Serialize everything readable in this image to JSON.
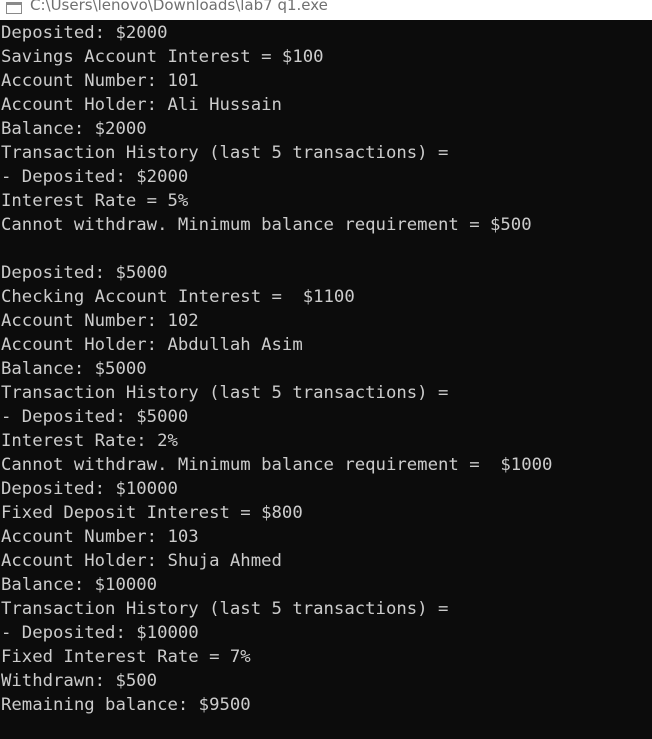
{
  "window": {
    "title": "C:\\Users\\lenovo\\Downloads\\lab7 q1.exe",
    "icon": "console-app-icon"
  },
  "console": {
    "lines": [
      "Deposited: $2000",
      "Savings Account Interest = $100",
      "Account Number: 101",
      "Account Holder: Ali Hussain",
      "Balance: $2000",
      "Transaction History (last 5 transactions) =",
      "- Deposited: $2000",
      "Interest Rate = 5%",
      "Cannot withdraw. Minimum balance requirement = $500",
      "",
      "Deposited: $5000",
      "Checking Account Interest =  $1100",
      "Account Number: 102",
      "Account Holder: Abdullah Asim",
      "Balance: $5000",
      "Transaction History (last 5 transactions) =",
      "- Deposited: $5000",
      "Interest Rate: 2%",
      "Cannot withdraw. Minimum balance requirement =  $1000",
      "Deposited: $10000",
      "Fixed Deposit Interest = $800",
      "Account Number: 103",
      "Account Holder: Shuja Ahmed",
      "Balance: $10000",
      "Transaction History (last 5 transactions) =",
      "- Deposited: $10000",
      "Fixed Interest Rate = 7%",
      "Withdrawn: $500",
      "Remaining balance: $9500"
    ]
  }
}
